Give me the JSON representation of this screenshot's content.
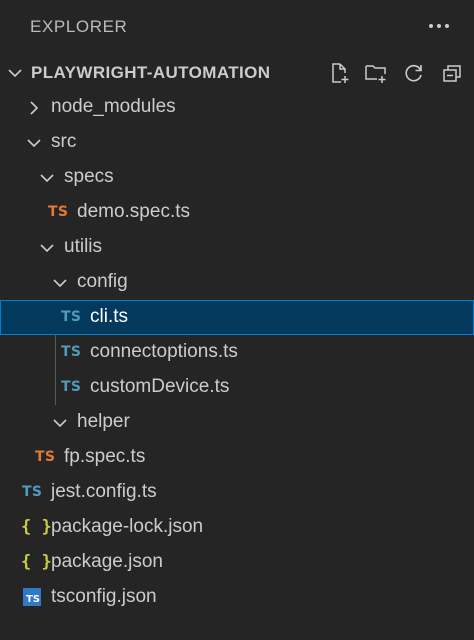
{
  "explorer": {
    "title": "EXPLORER",
    "more_icon": "ellipsis-icon"
  },
  "section": {
    "title": "PLAYWRIGHT-AUTOMATION",
    "expanded": true,
    "actions": [
      {
        "name": "new-file-icon"
      },
      {
        "name": "new-folder-icon"
      },
      {
        "name": "refresh-icon"
      },
      {
        "name": "collapse-all-icon"
      }
    ]
  },
  "tree": [
    {
      "label": "node_modules",
      "kind": "folder",
      "expanded": false
    },
    {
      "label": "src",
      "kind": "folder",
      "expanded": true
    },
    {
      "label": "specs",
      "kind": "folder",
      "expanded": true
    },
    {
      "label": "demo.spec.ts",
      "kind": "file",
      "badge": "TS",
      "badge_color": "#e37933"
    },
    {
      "label": "utilis",
      "kind": "folder",
      "expanded": true
    },
    {
      "label": "config",
      "kind": "folder",
      "expanded": true
    },
    {
      "label": "cli.ts",
      "kind": "file",
      "badge": "TS",
      "badge_color": "#519aba",
      "selected": true
    },
    {
      "label": "connectoptions.ts",
      "kind": "file",
      "badge": "TS",
      "badge_color": "#519aba"
    },
    {
      "label": "customDevice.ts",
      "kind": "file",
      "badge": "TS",
      "badge_color": "#519aba"
    },
    {
      "label": "helper",
      "kind": "folder",
      "expanded": false
    },
    {
      "label": "fp.spec.ts",
      "kind": "file",
      "badge": "TS",
      "badge_color": "#e37933"
    },
    {
      "label": "jest.config.ts",
      "kind": "file",
      "badge": "TS",
      "badge_color": "#519aba"
    },
    {
      "label": "package-lock.json",
      "kind": "file",
      "badge": "{ }",
      "badge_color": "#cbcb41"
    },
    {
      "label": "package.json",
      "kind": "file",
      "badge": "{ }",
      "badge_color": "#cbcb41"
    },
    {
      "label": "tsconfig.json",
      "kind": "file",
      "badge": "TS",
      "badge_color": "#3178c6"
    }
  ],
  "colors": {
    "background": "#252526",
    "selection": "#04395e",
    "selection_border": "#007fd4"
  }
}
